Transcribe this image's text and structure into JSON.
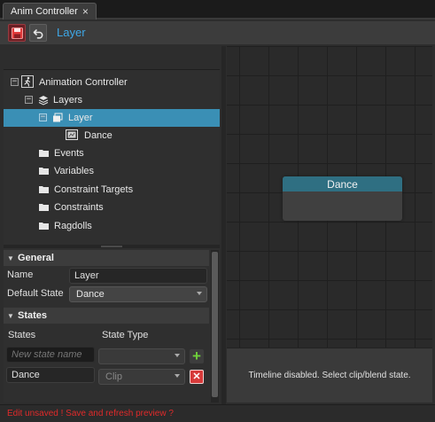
{
  "tab": {
    "title": "Anim Controller",
    "close_glyph": "×"
  },
  "toolbar": {
    "title": "Layer",
    "save_icon": "save-icon",
    "undo_icon": "undo-icon"
  },
  "tree": {
    "items": [
      {
        "label": "Animation Controller",
        "icon": "running-figure-icon",
        "expander": "minus"
      },
      {
        "label": "Layers",
        "icon": "layers-icon",
        "expander": "minus"
      },
      {
        "label": "Layer",
        "icon": "layer-icon",
        "expander": "minus",
        "selected": true
      },
      {
        "label": "Dance",
        "icon": "clip-icon"
      },
      {
        "label": "Events",
        "icon": "folder-icon"
      },
      {
        "label": "Variables",
        "icon": "folder-icon"
      },
      {
        "label": "Constraint Targets",
        "icon": "folder-icon"
      },
      {
        "label": "Constraints",
        "icon": "folder-icon"
      },
      {
        "label": "Ragdolls",
        "icon": "folder-icon"
      }
    ]
  },
  "general": {
    "header": "General",
    "name_label": "Name",
    "name_value": "Layer",
    "default_state_label": "Default State",
    "default_state_value": "Dance"
  },
  "states": {
    "header": "States",
    "col_states": "States",
    "col_state_type": "State Type",
    "new_state_placeholder": "New state name",
    "rows": [
      {
        "name": "Dance",
        "type": "Clip"
      }
    ]
  },
  "graph": {
    "node_label": "Dance"
  },
  "timeline": {
    "message": "Timeline disabled. Select clip/blend state."
  },
  "status": {
    "message": "Edit unsaved ! Save and refresh preview ?",
    "color": "#e02a2a"
  },
  "colors": {
    "accent": "#3ea7e6",
    "selection": "#3a8fb5",
    "node_header": "#2f6f82"
  }
}
